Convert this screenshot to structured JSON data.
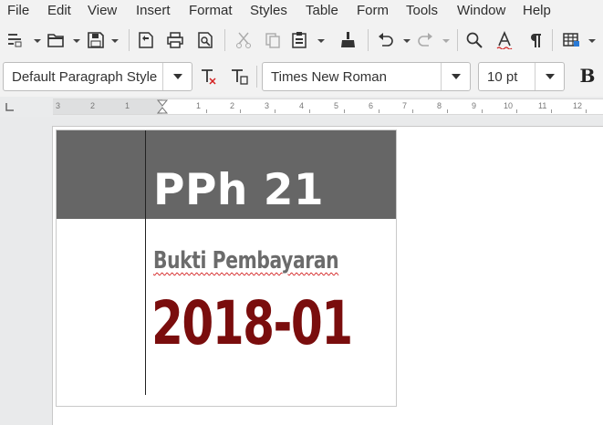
{
  "menu": [
    "File",
    "Edit",
    "View",
    "Insert",
    "Format",
    "Styles",
    "Table",
    "Form",
    "Tools",
    "Window",
    "Help"
  ],
  "toolbar1": {
    "icons": [
      "new-document-icon",
      "open-folder-icon",
      "save-icon",
      "export-pdf-icon",
      "print-icon",
      "print-preview-icon",
      "cut-icon",
      "copy-icon",
      "paste-icon",
      "clone-formatting-icon",
      "undo-icon",
      "redo-icon",
      "find-replace-icon",
      "spelling-icon",
      "formatting-marks-icon",
      "insert-table-icon"
    ]
  },
  "toolbar2": {
    "paragraph_style": "Default Paragraph Style",
    "font_name": "Times New Roman",
    "font_size": "10 pt",
    "bold_label": "B"
  },
  "ruler": {
    "numbers": [
      "3",
      "2",
      "1",
      "1",
      "1",
      "2",
      "3",
      "4",
      "5",
      "6",
      "7",
      "8",
      "9",
      "10",
      "11",
      "12"
    ]
  },
  "document": {
    "title": "PPh 21",
    "subtitle": "Bukti Pembayaran",
    "period": "2018-01",
    "colors": {
      "header_bg": "#666666",
      "title": "#ffffff",
      "subtitle": "#6b6b6b",
      "period": "#7a0d0d"
    }
  }
}
